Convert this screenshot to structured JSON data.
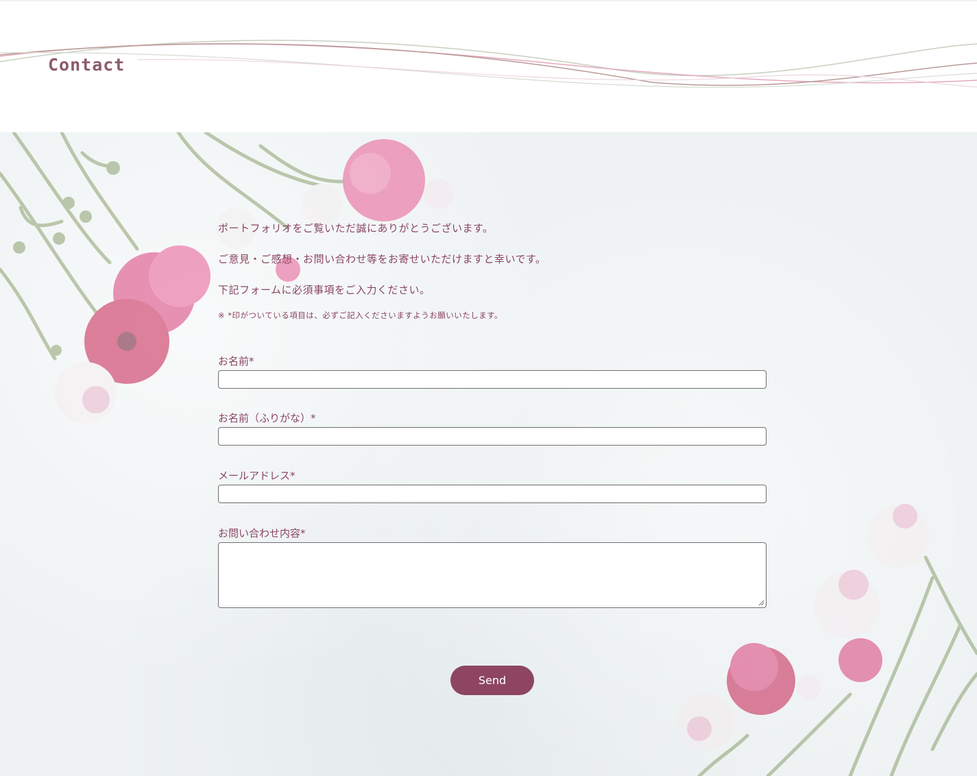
{
  "header": {
    "title": "Contact"
  },
  "intro": {
    "line1": "ポートフォリオをご覧いただ誠にありがとうございます。",
    "line2": "ご意見・ご感想・お問い合わせ等をお寄せいただけますと幸いです。",
    "line3": "下記フォームに必須事項をご入力ください。",
    "note": "※ *印がついている項目は、必ずご記入くださいますようお願いいたします。"
  },
  "form": {
    "name_label": "お名前*",
    "name_value": "",
    "kana_label": "お名前（ふりがな）*",
    "kana_value": "",
    "email_label": "メールアドレス*",
    "email_value": "",
    "message_label": "お問い合わせ内容*",
    "message_value": "",
    "send_label": "Send"
  },
  "colors": {
    "accent": "#8d4562",
    "text": "#8a4560",
    "title": "#8d5a6e",
    "background": "#eef2f3"
  }
}
